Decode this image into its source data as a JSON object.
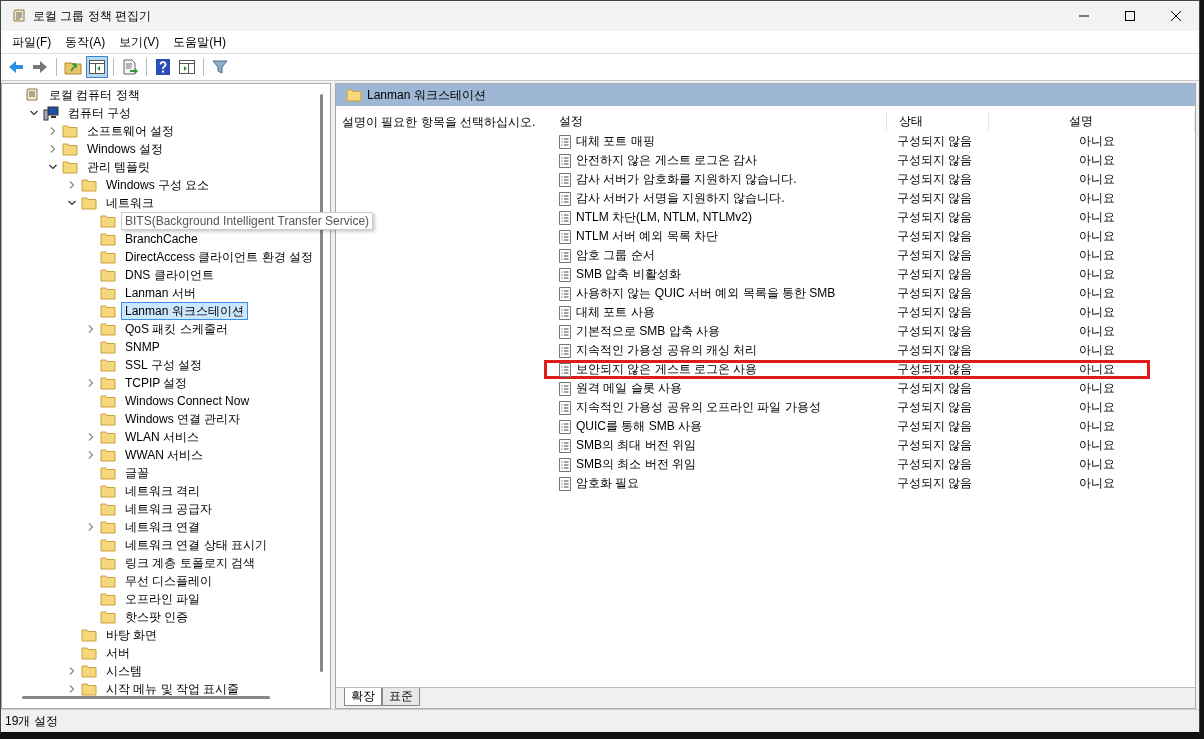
{
  "window": {
    "title": "로컬 그룹 정책 편집기"
  },
  "menu": [
    "파일(F)",
    "동작(A)",
    "보기(V)",
    "도움말(H)"
  ],
  "toolbar": [
    {
      "kind": "back",
      "pressed": false
    },
    {
      "kind": "forward",
      "pressed": false
    },
    {
      "kind": "sep"
    },
    {
      "kind": "up",
      "pressed": false
    },
    {
      "kind": "tree",
      "pressed": true
    },
    {
      "kind": "sep"
    },
    {
      "kind": "export",
      "pressed": false
    },
    {
      "kind": "sep"
    },
    {
      "kind": "help",
      "pressed": false
    },
    {
      "kind": "pane",
      "pressed": false
    },
    {
      "kind": "sep"
    },
    {
      "kind": "filter",
      "pressed": false
    }
  ],
  "tree": [
    {
      "label": "로컬 컴퓨터 정책",
      "kind": "policy",
      "selected": false,
      "children": [
        {
          "label": "컴퓨터 구성",
          "kind": "computer",
          "expanded": true,
          "selected": false,
          "children": [
            {
              "label": "소프트웨어 설정",
              "kind": "folder",
              "expanded": false,
              "selected": false
            },
            {
              "label": "Windows 설정",
              "kind": "folder",
              "expanded": false,
              "selected": false
            },
            {
              "label": "관리 템플릿",
              "kind": "folder",
              "expanded": true,
              "selected": false,
              "children": [
                {
                  "label": "Windows 구성 요소",
                  "kind": "folder",
                  "expanded": false,
                  "selected": false
                },
                {
                  "label": "네트워크",
                  "kind": "folder",
                  "expanded": true,
                  "selected": false,
                  "children": [
                    {
                      "label": "BITS(Background Intelligent Transfer Service)",
                      "kind": "folder",
                      "selected": false,
                      "tooltip": true
                    },
                    {
                      "label": "BranchCache",
                      "kind": "folder",
                      "selected": false
                    },
                    {
                      "label": "DirectAccess 클라이언트 환경 설정",
                      "kind": "folder",
                      "selected": false
                    },
                    {
                      "label": "DNS 클라이언트",
                      "kind": "folder",
                      "selected": false
                    },
                    {
                      "label": "Lanman 서버",
                      "kind": "folder",
                      "selected": false
                    },
                    {
                      "label": "Lanman 워크스테이션",
                      "kind": "folder",
                      "selected": true
                    },
                    {
                      "label": "QoS 패킷 스케줄러",
                      "kind": "folder",
                      "expanded": false,
                      "selected": false
                    },
                    {
                      "label": "SNMP",
                      "kind": "folder",
                      "selected": false
                    },
                    {
                      "label": "SSL 구성 설정",
                      "kind": "folder",
                      "selected": false
                    },
                    {
                      "label": "TCPIP 설정",
                      "kind": "folder",
                      "expanded": false,
                      "selected": false
                    },
                    {
                      "label": "Windows Connect Now",
                      "kind": "folder",
                      "selected": false
                    },
                    {
                      "label": "Windows 연결 관리자",
                      "kind": "folder",
                      "selected": false
                    },
                    {
                      "label": "WLAN 서비스",
                      "kind": "folder",
                      "expanded": false,
                      "selected": false
                    },
                    {
                      "label": "WWAN 서비스",
                      "kind": "folder",
                      "expanded": false,
                      "selected": false
                    },
                    {
                      "label": "글꼴",
                      "kind": "folder",
                      "selected": false
                    },
                    {
                      "label": "네트워크 격리",
                      "kind": "folder",
                      "selected": false
                    },
                    {
                      "label": "네트워크 공급자",
                      "kind": "folder",
                      "selected": false
                    },
                    {
                      "label": "네트워크 연결",
                      "kind": "folder",
                      "expanded": false,
                      "selected": false
                    },
                    {
                      "label": "네트워크 연결 상태 표시기",
                      "kind": "folder",
                      "selected": false
                    },
                    {
                      "label": "링크 계층 토폴로지 검색",
                      "kind": "folder",
                      "selected": false
                    },
                    {
                      "label": "무선 디스플레이",
                      "kind": "folder",
                      "selected": false
                    },
                    {
                      "label": "오프라인 파일",
                      "kind": "folder",
                      "selected": false
                    },
                    {
                      "label": "핫스팟 인증",
                      "kind": "folder",
                      "selected": false
                    }
                  ]
                },
                {
                  "label": "바탕 화면",
                  "kind": "folder",
                  "selected": false
                },
                {
                  "label": "서버",
                  "kind": "folder",
                  "selected": false
                },
                {
                  "label": "시스템",
                  "kind": "folder",
                  "expanded": false,
                  "selected": false
                },
                {
                  "label": "시작 메뉴 및 작업 표시줄",
                  "kind": "folder",
                  "expanded": false,
                  "selected": false
                }
              ]
            }
          ]
        }
      ]
    }
  ],
  "detail": {
    "title": "Lanman 워크스테이션",
    "description": "설명이 필요한 항목을 선택하십시오.",
    "columns": [
      "설정",
      "상태",
      "설명"
    ],
    "rows": [
      {
        "setting": "대체 포트 매핑",
        "state": "구성되지 않음",
        "comment": "아니요",
        "highlighted": false
      },
      {
        "setting": "안전하지 않은 게스트 로그온 감사",
        "state": "구성되지 않음",
        "comment": "아니요",
        "highlighted": false
      },
      {
        "setting": "감사 서버가 암호화를 지원하지 않습니다.",
        "state": "구성되지 않음",
        "comment": "아니요",
        "highlighted": false
      },
      {
        "setting": "감사 서버가 서명을 지원하지 않습니다.",
        "state": "구성되지 않음",
        "comment": "아니요",
        "highlighted": false
      },
      {
        "setting": "NTLM 차단(LM, NTLM, NTLMv2)",
        "state": "구성되지 않음",
        "comment": "아니요",
        "highlighted": false
      },
      {
        "setting": "NTLM 서버 예외 목록 차단",
        "state": "구성되지 않음",
        "comment": "아니요",
        "highlighted": false
      },
      {
        "setting": "암호 그룹 순서",
        "state": "구성되지 않음",
        "comment": "아니요",
        "highlighted": false
      },
      {
        "setting": "SMB 압축 비활성화",
        "state": "구성되지 않음",
        "comment": "아니요",
        "highlighted": false
      },
      {
        "setting": "사용하지 않는 QUIC 서버 예외 목록을 통한 SMB",
        "state": "구성되지 않음",
        "comment": "아니요",
        "highlighted": false
      },
      {
        "setting": "대체 포트 사용",
        "state": "구성되지 않음",
        "comment": "아니요",
        "highlighted": false
      },
      {
        "setting": "기본적으로 SMB 압축 사용",
        "state": "구성되지 않음",
        "comment": "아니요",
        "highlighted": false
      },
      {
        "setting": "지속적인 가용성 공유의 캐싱 처리",
        "state": "구성되지 않음",
        "comment": "아니요",
        "highlighted": false
      },
      {
        "setting": "보안되지 않은 게스트 로그온 사용",
        "state": "구성되지 않음",
        "comment": "아니요",
        "highlighted": true
      },
      {
        "setting": "원격 메일 슬롯 사용",
        "state": "구성되지 않음",
        "comment": "아니요",
        "highlighted": false
      },
      {
        "setting": "지속적인 가용성 공유의 오프라인 파일 가용성",
        "state": "구성되지 않음",
        "comment": "아니요",
        "highlighted": false
      },
      {
        "setting": "QUIC를 통해 SMB 사용",
        "state": "구성되지 않음",
        "comment": "아니요",
        "highlighted": false
      },
      {
        "setting": "SMB의 최대 버전 위임",
        "state": "구성되지 않음",
        "comment": "아니요",
        "highlighted": false
      },
      {
        "setting": "SMB의 최소 버전 위임",
        "state": "구성되지 않음",
        "comment": "아니요",
        "highlighted": false
      },
      {
        "setting": "암호화 필요",
        "state": "구성되지 않음",
        "comment": "아니요",
        "highlighted": false
      }
    ]
  },
  "view_tabs": [
    {
      "label": "확장",
      "selected": true
    },
    {
      "label": "표준",
      "selected": false
    }
  ],
  "status_bar": "19개 설정"
}
